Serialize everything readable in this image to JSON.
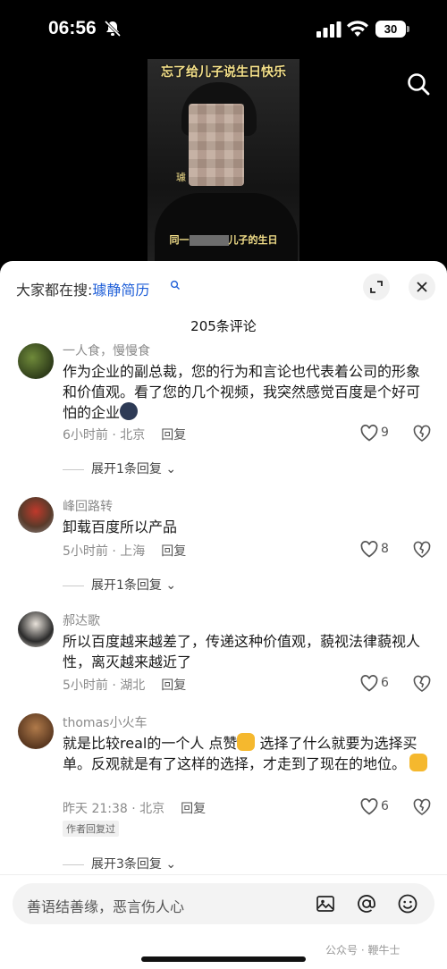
{
  "status": {
    "time": "06:56",
    "battery": "30"
  },
  "video": {
    "title": "忘了给儿子说生日快乐",
    "name_tag": "璩",
    "caption_left": "同一",
    "caption_right": "儿子的生日"
  },
  "sheet": {
    "lead": "大家都在搜:",
    "query": "璩静简历",
    "count": "205条评论"
  },
  "comments": [
    {
      "user": "一人食，慢慢食",
      "text": "作为企业的副总裁，您的行为和言论也代表着公司的形象和价值观。看了您的几个视频，我突然感觉百度是个好可怕的企业",
      "time": "6小时前 · 北京",
      "reply": "回复",
      "likes": "9",
      "expand": "展开1条回复"
    },
    {
      "user": "峰回路转",
      "text": "卸载百度所以产品",
      "time": "5小时前 · 上海",
      "reply": "回复",
      "likes": "8",
      "expand": "展开1条回复"
    },
    {
      "user": "郝达歌",
      "text": "所以百度越来越差了，传递这种价值观，藐视法律藐视人性，离灭越来越近了",
      "time": "5小时前 · 湖北",
      "reply": "回复",
      "likes": "6"
    },
    {
      "user": "thomas小火车",
      "text1": "就是比较real的一个人 点赞",
      "text2": " 选择了什么就要为选择买单。反观就是有了这样的选择，才走到了现在的地位。",
      "time": "昨天 21:38 · 北京",
      "reply": "回复",
      "likes": "6",
      "author_tag": "作者回复过",
      "expand": "展开3条回复"
    }
  ],
  "input": {
    "placeholder": "善语结善缘，恶言伤人心"
  },
  "watermark": "公众号 · 鞭牛士"
}
